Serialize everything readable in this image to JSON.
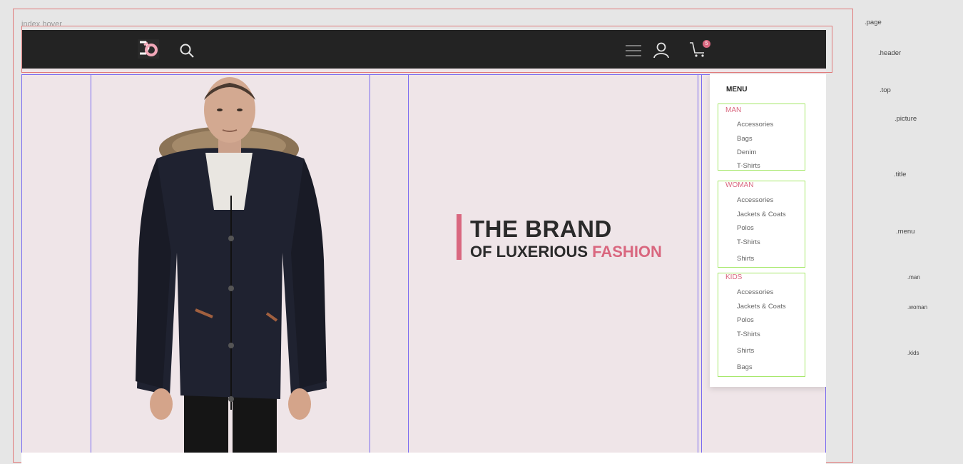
{
  "frame_label": "index hover",
  "header": {
    "cart_count": "5",
    "icons": [
      "logo",
      "search-icon",
      "menu-icon",
      "user-icon",
      "cart-icon"
    ]
  },
  "hero": {
    "title_main": "THE BRAND",
    "title_sub_prefix": "OF LUXERIOUS",
    "title_sub_accent": "FASHION"
  },
  "menu": {
    "heading": "MENU",
    "groups": [
      {
        "title": "MAN",
        "items": [
          "Accessories",
          "Bags",
          "Denim",
          "T-Shirts"
        ]
      },
      {
        "title": "WOMAN",
        "items": [
          "Accessories",
          "Jackets & Coats",
          "Polos",
          "T-Shirts",
          "Shirts"
        ]
      },
      {
        "title": "KIDS",
        "items": [
          "Accessories",
          "Jackets & Coats",
          "Polos",
          "T-Shirts",
          "Shirts",
          "Bags"
        ]
      }
    ]
  },
  "annotations": [
    ".page",
    ".header",
    ".top",
    ".picture",
    ".title",
    ".menu",
    ".man",
    ".woman",
    ".kids"
  ],
  "colors": {
    "accent": "#d9677f",
    "header_bg": "#232323",
    "canvas_bg": "#efe5e8",
    "guide_red": "#e07a7a",
    "guide_purple": "#7a6bf0",
    "guide_green": "#a6e86a"
  }
}
